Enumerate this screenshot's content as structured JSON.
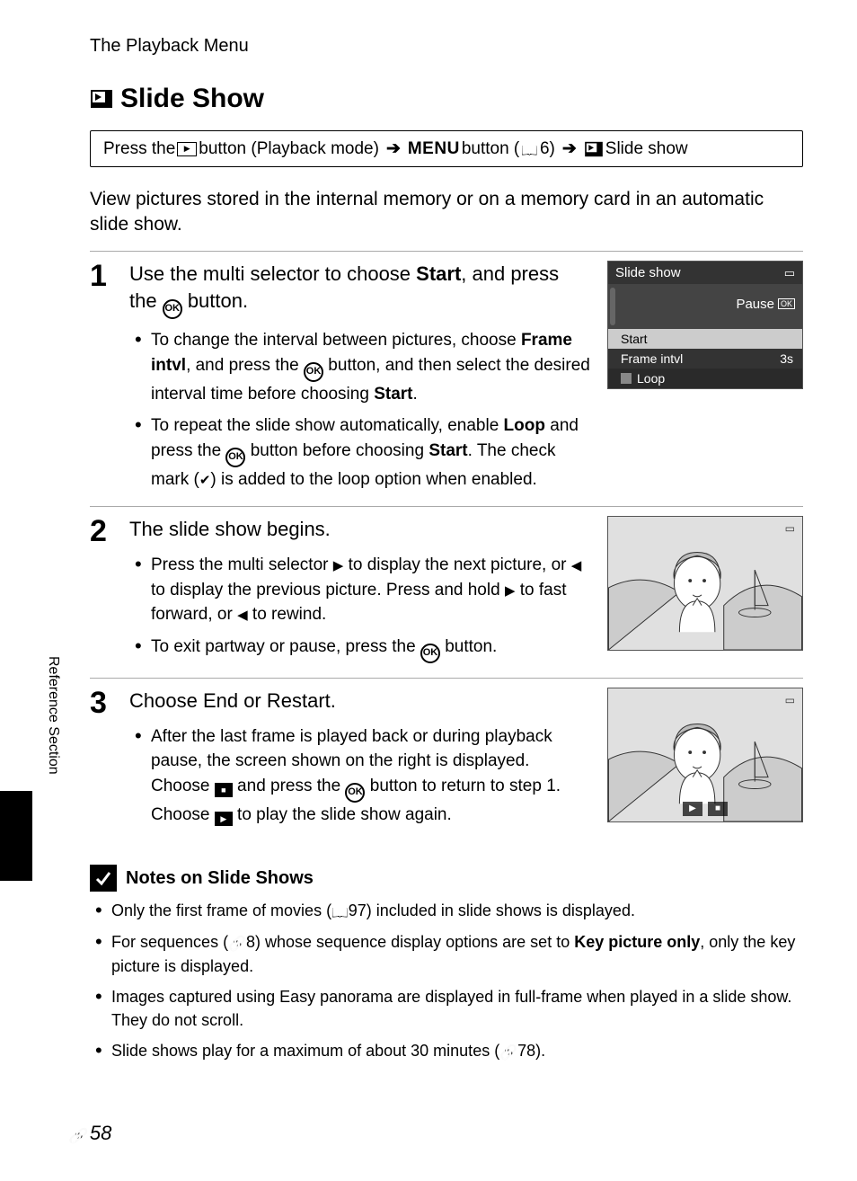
{
  "running_head": "The Playback Menu",
  "section_title": "Slide Show",
  "nav": {
    "press_the": "Press the ",
    "playback_mode": " button (Playback mode) ",
    "menu": "MENU",
    "button": " button (",
    "ref1": "6) ",
    "slide_show": " Slide show"
  },
  "intro": "View pictures stored in the internal memory or on a memory card in an automatic slide show.",
  "steps": [
    {
      "num": "1",
      "head_a": "Use the multi selector to choose ",
      "head_bold": "Start",
      "head_b": ", and press the ",
      "head_c": " button.",
      "bullets": [
        {
          "a": "To change the interval between pictures, choose ",
          "b": "Frame intvl",
          "c": ", and press the ",
          "d": " button, and then select the desired interval time before choosing ",
          "e": "Start",
          "f": "."
        },
        {
          "a": "To repeat the slide show automatically, enable ",
          "b": "Loop",
          "c": " and press the ",
          "d": " button before choosing ",
          "e": "Start",
          "f": ". The check mark (",
          "g": ") is added to the loop option when enabled."
        }
      ],
      "screen": {
        "title": "Slide show",
        "pause": "Pause",
        "rows": [
          {
            "label": "Start",
            "value": ""
          },
          {
            "label": "Frame intvl",
            "value": "3s"
          },
          {
            "label": "Loop",
            "value": ""
          }
        ]
      }
    },
    {
      "num": "2",
      "head": "The slide show begins.",
      "bullets": [
        {
          "a": "Press the multi selector ",
          "b": " to display the next picture, or ",
          "c": " to display the previous picture. Press and hold ",
          "d": " to fast forward, or ",
          "e": " to rewind."
        },
        {
          "a": "To exit partway or pause, press the ",
          "b": " button."
        }
      ]
    },
    {
      "num": "3",
      "head": "Choose End or Restart.",
      "bullets": [
        {
          "a": "After the last frame is played back or during playback pause, the screen shown on the right is displayed. Choose ",
          "b": " and press the ",
          "c": " button to return to step 1. Choose ",
          "d": " to play the slide show again."
        }
      ]
    }
  ],
  "notes": {
    "title": "Notes on Slide Shows",
    "items": [
      {
        "a": "Only the first frame of movies (",
        "ref": "97",
        "b": ") included in slide shows is displayed."
      },
      {
        "a": "For sequences (",
        "ref": "8",
        "b": ") whose sequence display options are set to ",
        "bold": "Key picture only",
        "c": ", only the key picture is displayed."
      },
      {
        "a": "Images captured using Easy panorama are displayed in full-frame when played in a slide show. They do not scroll."
      },
      {
        "a": "Slide shows play for a maximum of about 30 minutes (",
        "ref": "78",
        "b": ")."
      }
    ]
  },
  "side_label": "Reference Section",
  "page_number": "58"
}
